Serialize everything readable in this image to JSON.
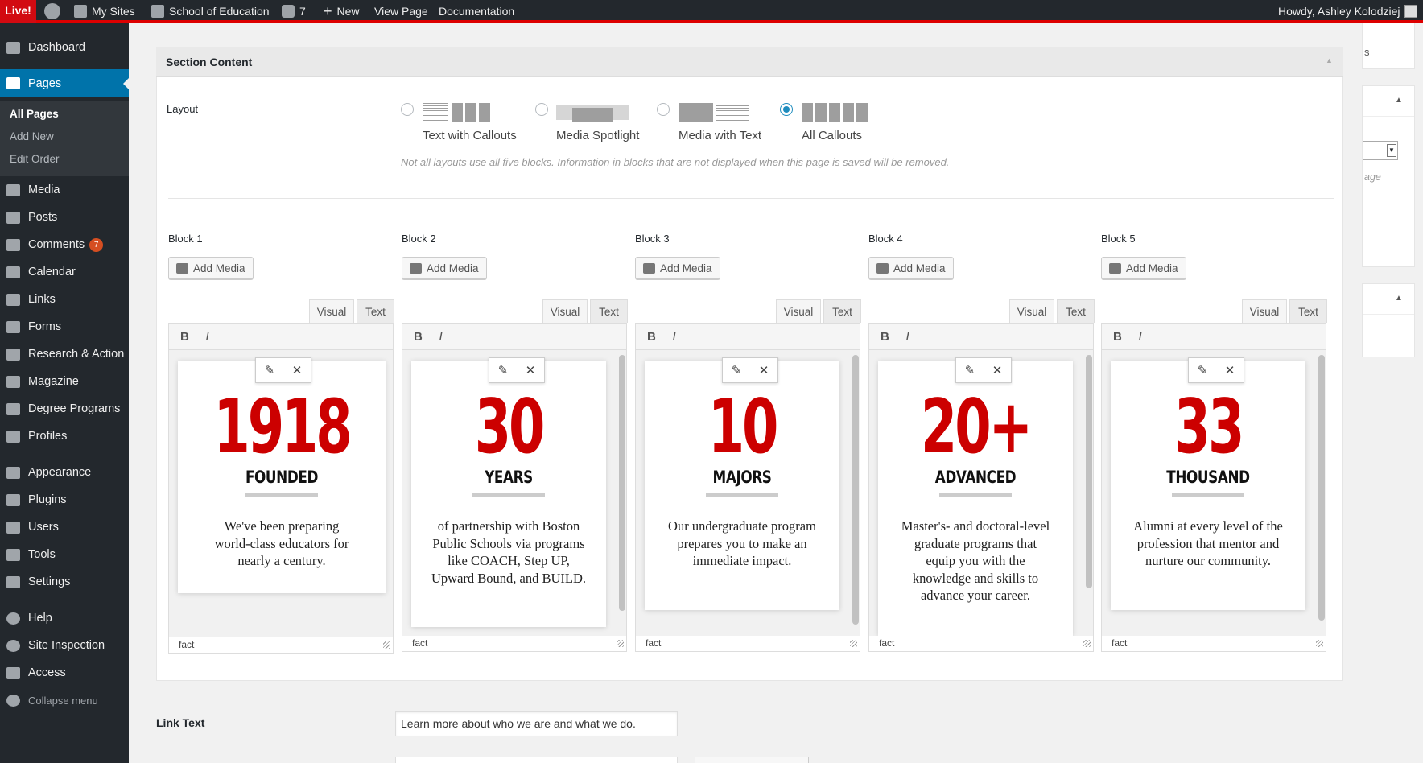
{
  "adminbar": {
    "live": "Live!",
    "my_sites": "My Sites",
    "site_name": "School of Education",
    "comments_count": "7",
    "new": "New",
    "view_page": "View Page",
    "documentation": "Documentation",
    "howdy": "Howdy, Ashley Kolodziej"
  },
  "sidebar": {
    "dashboard": "Dashboard",
    "pages": "Pages",
    "sub_all_pages": "All Pages",
    "sub_add_new": "Add New",
    "sub_edit_order": "Edit Order",
    "media": "Media",
    "posts": "Posts",
    "comments": "Comments",
    "comments_badge": "7",
    "calendar": "Calendar",
    "links": "Links",
    "forms": "Forms",
    "research": "Research & Action",
    "magazine": "Magazine",
    "degree_programs": "Degree Programs",
    "profiles": "Profiles",
    "appearance": "Appearance",
    "plugins": "Plugins",
    "users": "Users",
    "tools": "Tools",
    "settings": "Settings",
    "help": "Help",
    "site_inspection": "Site Inspection",
    "access": "Access",
    "collapse": "Collapse menu"
  },
  "section": {
    "title": "Section Content",
    "layout_label": "Layout",
    "layouts": [
      "Text with Callouts",
      "Media Spotlight",
      "Media with Text",
      "All Callouts"
    ],
    "selected_layout": "All Callouts",
    "note": "Not all layouts use all five blocks. Information in blocks that are not displayed when this page is saved will be removed."
  },
  "blocks": [
    {
      "label": "Block 1",
      "add_media": "Add Media",
      "tab_visual": "Visual",
      "tab_text": "Text",
      "number": "1918",
      "word": "FOUNDED",
      "desc": "We've been preparing world-class educators for nearly a century.",
      "status": "fact"
    },
    {
      "label": "Block 2",
      "add_media": "Add Media",
      "tab_visual": "Visual",
      "tab_text": "Text",
      "number": "30",
      "word": "YEARS",
      "desc": "of partnership with Boston Public Schools via programs like COACH, Step UP, Upward Bound, and BUILD.",
      "status": "fact"
    },
    {
      "label": "Block 3",
      "add_media": "Add Media",
      "tab_visual": "Visual",
      "tab_text": "Text",
      "number": "10",
      "word": "MAJORS",
      "desc": "Our undergraduate program prepares you to make an immediate impact.",
      "status": "fact"
    },
    {
      "label": "Block 4",
      "add_media": "Add Media",
      "tab_visual": "Visual",
      "tab_text": "Text",
      "number": "20+",
      "word": "ADVANCED",
      "desc": "Master's- and doctoral-level graduate programs that equip you with the knowledge and skills to advance your career.",
      "status": "fact"
    },
    {
      "label": "Block 5",
      "add_media": "Add Media",
      "tab_visual": "Visual",
      "tab_text": "Text",
      "number": "33",
      "word": "THOUSAND",
      "desc": "Alumni at every level of the profession that mentor and nurture our community.",
      "status": "fact"
    }
  ],
  "link": {
    "label": "Link Text",
    "value": "Learn more about who we are and what we do."
  },
  "rightcol": {
    "frag1": "s",
    "frag2": "age"
  },
  "toolbar_icons": {
    "bold": "B",
    "italic": "I",
    "edit": "✎",
    "remove": "✕"
  }
}
